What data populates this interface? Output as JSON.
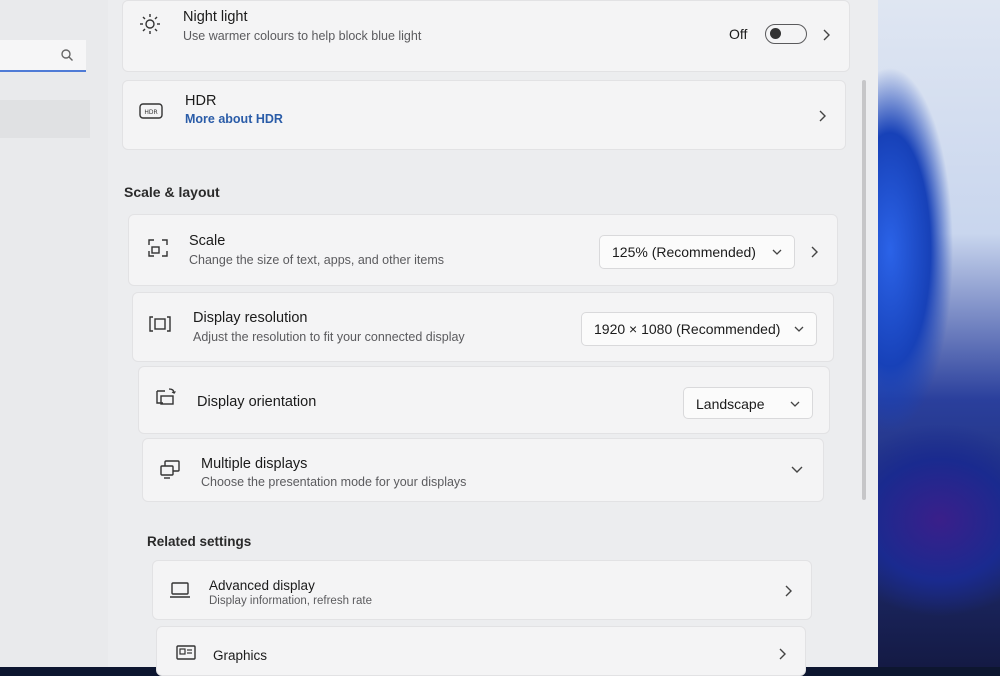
{
  "night_light": {
    "title": "Night light",
    "subtitle": "Use warmer colours to help block blue light",
    "state": "Off"
  },
  "hdr": {
    "title": "HDR",
    "link": "More about HDR"
  },
  "scale_layout": {
    "heading": "Scale & layout",
    "scale": {
      "title": "Scale",
      "subtitle": "Change the size of text, apps, and other items",
      "value": "125% (Recommended)"
    },
    "resolution": {
      "title": "Display resolution",
      "subtitle": "Adjust the resolution to fit your connected display",
      "value": "1920 × 1080 (Recommended)"
    },
    "orientation": {
      "title": "Display orientation",
      "value": "Landscape"
    },
    "multiple": {
      "title": "Multiple displays",
      "subtitle": "Choose the presentation mode for your displays"
    }
  },
  "related": {
    "heading": "Related settings",
    "advanced": {
      "title": "Advanced display",
      "subtitle": "Display information, refresh rate"
    },
    "graphics": {
      "title": "Graphics"
    }
  },
  "colors": {
    "accent": "#2a5ca8",
    "search_underline": "#4f7bd6"
  }
}
